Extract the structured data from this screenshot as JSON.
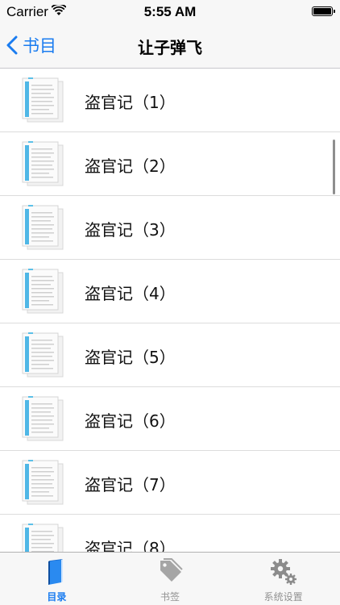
{
  "status_bar": {
    "carrier": "Carrier",
    "time": "5:55 AM"
  },
  "nav": {
    "back_label": "书目",
    "title": "让子弹飞"
  },
  "list": {
    "items": [
      {
        "label": "盗官记（1）"
      },
      {
        "label": "盗官记（2）"
      },
      {
        "label": "盗官记（3）"
      },
      {
        "label": "盗官记（4）"
      },
      {
        "label": "盗官记（5）"
      },
      {
        "label": "盗官记（6）"
      },
      {
        "label": "盗官记（7）"
      },
      {
        "label": "盗官记（8）"
      }
    ]
  },
  "tab_bar": {
    "tabs": [
      {
        "label": "目录",
        "icon": "book-icon",
        "active": true
      },
      {
        "label": "书签",
        "icon": "tag-icon",
        "active": false
      },
      {
        "label": "系统设置",
        "icon": "gear-icon",
        "active": false
      }
    ]
  },
  "colors": {
    "accent": "#1a7cf0",
    "inactive": "#929292"
  }
}
